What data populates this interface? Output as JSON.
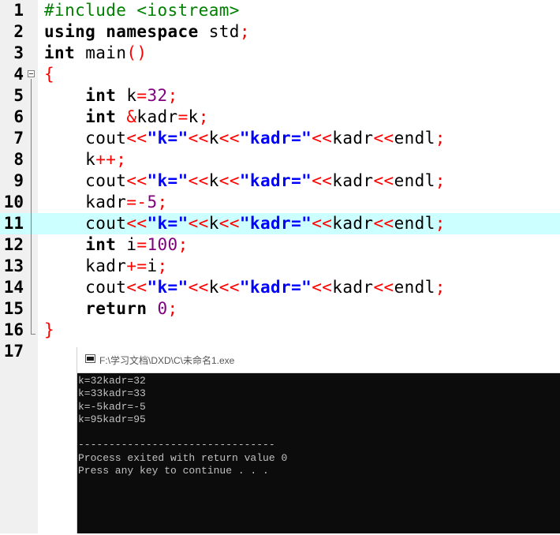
{
  "editor": {
    "lines": [
      {
        "n": "1",
        "tokens": [
          {
            "t": "#include <iostream>",
            "c": "pre"
          }
        ]
      },
      {
        "n": "2",
        "tokens": [
          {
            "t": "using namespace ",
            "c": "kw"
          },
          {
            "t": "std",
            "c": "id"
          },
          {
            "t": ";",
            "c": "op"
          }
        ]
      },
      {
        "n": "3",
        "tokens": [
          {
            "t": "int ",
            "c": "kw"
          },
          {
            "t": "main",
            "c": "id"
          },
          {
            "t": "()",
            "c": "op"
          }
        ]
      },
      {
        "n": "4",
        "tokens": [
          {
            "t": "{",
            "c": "op"
          }
        ]
      },
      {
        "n": "5",
        "tokens": [
          {
            "t": "    ",
            "c": "id"
          },
          {
            "t": "int ",
            "c": "kw"
          },
          {
            "t": "k",
            "c": "id"
          },
          {
            "t": "=",
            "c": "op"
          },
          {
            "t": "32",
            "c": "num"
          },
          {
            "t": ";",
            "c": "op"
          }
        ]
      },
      {
        "n": "6",
        "tokens": [
          {
            "t": "    ",
            "c": "id"
          },
          {
            "t": "int ",
            "c": "kw"
          },
          {
            "t": "&",
            "c": "op"
          },
          {
            "t": "kadr",
            "c": "id"
          },
          {
            "t": "=",
            "c": "op"
          },
          {
            "t": "k",
            "c": "id"
          },
          {
            "t": ";",
            "c": "op"
          }
        ]
      },
      {
        "n": "7",
        "tokens": [
          {
            "t": "    cout",
            "c": "id"
          },
          {
            "t": "<<",
            "c": "op"
          },
          {
            "t": "\"k=\"",
            "c": "str"
          },
          {
            "t": "<<",
            "c": "op"
          },
          {
            "t": "k",
            "c": "id"
          },
          {
            "t": "<<",
            "c": "op"
          },
          {
            "t": "\"kadr=\"",
            "c": "str"
          },
          {
            "t": "<<",
            "c": "op"
          },
          {
            "t": "kadr",
            "c": "id"
          },
          {
            "t": "<<",
            "c": "op"
          },
          {
            "t": "endl",
            "c": "id"
          },
          {
            "t": ";",
            "c": "op"
          }
        ]
      },
      {
        "n": "8",
        "tokens": [
          {
            "t": "    k",
            "c": "id"
          },
          {
            "t": "++;",
            "c": "op"
          }
        ]
      },
      {
        "n": "9",
        "tokens": [
          {
            "t": "    cout",
            "c": "id"
          },
          {
            "t": "<<",
            "c": "op"
          },
          {
            "t": "\"k=\"",
            "c": "str"
          },
          {
            "t": "<<",
            "c": "op"
          },
          {
            "t": "k",
            "c": "id"
          },
          {
            "t": "<<",
            "c": "op"
          },
          {
            "t": "\"kadr=\"",
            "c": "str"
          },
          {
            "t": "<<",
            "c": "op"
          },
          {
            "t": "kadr",
            "c": "id"
          },
          {
            "t": "<<",
            "c": "op"
          },
          {
            "t": "endl",
            "c": "id"
          },
          {
            "t": ";",
            "c": "op"
          }
        ]
      },
      {
        "n": "10",
        "tokens": [
          {
            "t": "    kadr",
            "c": "id"
          },
          {
            "t": "=-",
            "c": "op"
          },
          {
            "t": "5",
            "c": "num"
          },
          {
            "t": ";",
            "c": "op"
          }
        ]
      },
      {
        "n": "11",
        "current": true,
        "tokens": [
          {
            "t": "    cout",
            "c": "id"
          },
          {
            "t": "<<",
            "c": "op"
          },
          {
            "t": "\"k=\"",
            "c": "str"
          },
          {
            "t": "<<",
            "c": "op"
          },
          {
            "t": "k",
            "c": "id"
          },
          {
            "t": "<<",
            "c": "op"
          },
          {
            "t": "\"kadr=\"",
            "c": "str"
          },
          {
            "t": "<<",
            "c": "op"
          },
          {
            "t": "kadr",
            "c": "id"
          },
          {
            "t": "<<",
            "c": "op"
          },
          {
            "t": "endl",
            "c": "id"
          },
          {
            "t": ";",
            "c": "op"
          }
        ]
      },
      {
        "n": "12",
        "tokens": [
          {
            "t": "    ",
            "c": "id"
          },
          {
            "t": "int ",
            "c": "kw"
          },
          {
            "t": "i",
            "c": "id"
          },
          {
            "t": "=",
            "c": "op"
          },
          {
            "t": "100",
            "c": "num"
          },
          {
            "t": ";",
            "c": "op"
          }
        ]
      },
      {
        "n": "13",
        "tokens": [
          {
            "t": "    kadr",
            "c": "id"
          },
          {
            "t": "+=",
            "c": "op"
          },
          {
            "t": "i",
            "c": "id"
          },
          {
            "t": ";",
            "c": "op"
          }
        ]
      },
      {
        "n": "14",
        "tokens": [
          {
            "t": "    cout",
            "c": "id"
          },
          {
            "t": "<<",
            "c": "op"
          },
          {
            "t": "\"k=\"",
            "c": "str"
          },
          {
            "t": "<<",
            "c": "op"
          },
          {
            "t": "k",
            "c": "id"
          },
          {
            "t": "<<",
            "c": "op"
          },
          {
            "t": "\"kadr=\"",
            "c": "str"
          },
          {
            "t": "<<",
            "c": "op"
          },
          {
            "t": "kadr",
            "c": "id"
          },
          {
            "t": "<<",
            "c": "op"
          },
          {
            "t": "endl",
            "c": "id"
          },
          {
            "t": ";",
            "c": "op"
          }
        ]
      },
      {
        "n": "15",
        "tokens": [
          {
            "t": "    ",
            "c": "id"
          },
          {
            "t": "return ",
            "c": "kw"
          },
          {
            "t": "0",
            "c": "num"
          },
          {
            "t": ";",
            "c": "op"
          }
        ]
      },
      {
        "n": "16",
        "tokens": [
          {
            "t": "}",
            "c": "op"
          }
        ]
      },
      {
        "n": "17",
        "tokens": []
      }
    ]
  },
  "console": {
    "icon": "console-window-icon",
    "title": "F:\\学习文档\\DXD\\C\\未命名1.exe",
    "output": "k=32kadr=32\nk=33kadr=33\nk=-5kadr=-5\nk=95kadr=95\n\n--------------------------------\nProcess exited with return value 0\nPress any key to continue . . ."
  },
  "colors": {
    "preprocessor": "#008000",
    "operator": "#ff0000",
    "number": "#800080",
    "string": "#0000ff",
    "current_line": "#ccffff"
  }
}
